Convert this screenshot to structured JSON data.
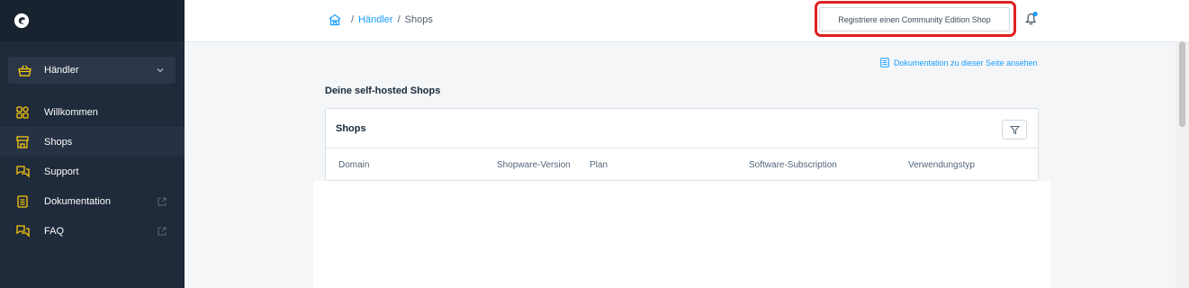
{
  "sidebar": {
    "logo_icon": "shopware-logo-icon",
    "merchant_select": {
      "label": "Händler",
      "icon": "basket-icon"
    },
    "items": [
      {
        "label": "Willkommen",
        "icon": "dashboard-icon"
      },
      {
        "label": "Shops",
        "icon": "store-icon"
      },
      {
        "label": "Support",
        "icon": "chat-icon"
      },
      {
        "label": "Dokumentation",
        "icon": "document-icon"
      },
      {
        "label": "FAQ",
        "icon": "chat-icon"
      }
    ]
  },
  "header": {
    "breadcrumb": {
      "home_icon": "home-icon",
      "sep": "/",
      "merchant": "Händler",
      "current": "Shops"
    },
    "register_button": "Registriere einen Community Edition Shop",
    "bell_icon": "bell-icon"
  },
  "main": {
    "doc_link": "Dokumentation zu dieser Seite ansehen",
    "section_title": "Deine self-hosted Shops",
    "card": {
      "title": "Shops",
      "columns": [
        "Domain",
        "Shopware-Version",
        "Plan",
        "Software-Subscription",
        "Verwendungstyp"
      ]
    }
  },
  "colors": {
    "sidebar_bg": "#1f2a3a",
    "accent_yellow": "#f9c80e",
    "link_blue": "#189eff",
    "highlight_red": "#e02020"
  }
}
